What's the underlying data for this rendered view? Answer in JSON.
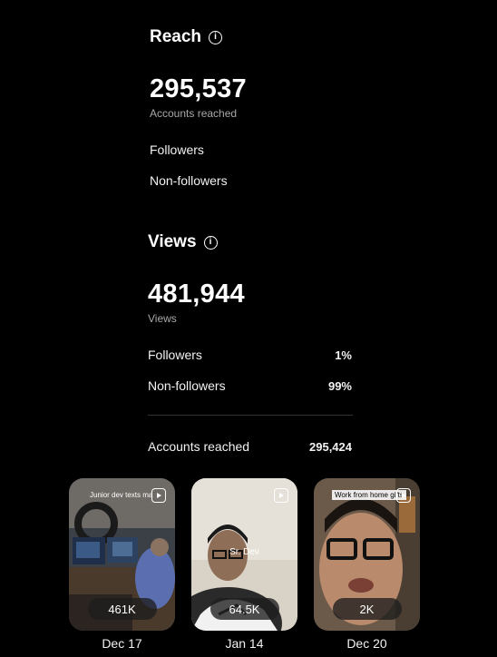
{
  "reach": {
    "title": "Reach",
    "total": "295,537",
    "total_label": "Accounts reached",
    "rows": [
      {
        "label": "Followers",
        "value": ""
      },
      {
        "label": "Non-followers",
        "value": ""
      }
    ]
  },
  "views": {
    "title": "Views",
    "total": "481,944",
    "total_label": "Views",
    "rows": [
      {
        "label": "Followers",
        "value": "1%"
      },
      {
        "label": "Non-followers",
        "value": "99%"
      }
    ],
    "accounts_reached_label": "Accounts reached",
    "accounts_reached_value": "295,424"
  },
  "icons": {
    "info": "info-icon",
    "reel": "reels-icon"
  },
  "reels": [
    {
      "caption": "Junior dev texts ma",
      "count": "461K",
      "date": "Dec 17"
    },
    {
      "caption": "Sr. Dev",
      "count": "64.5K",
      "date": "Jan 14"
    },
    {
      "caption": "Work from home gifts",
      "count": "2K",
      "date": "Dec 20"
    }
  ],
  "colors": {
    "background": "#000000",
    "text": "#ffffff",
    "muted": "#a8a8a8",
    "divider": "#333333"
  }
}
